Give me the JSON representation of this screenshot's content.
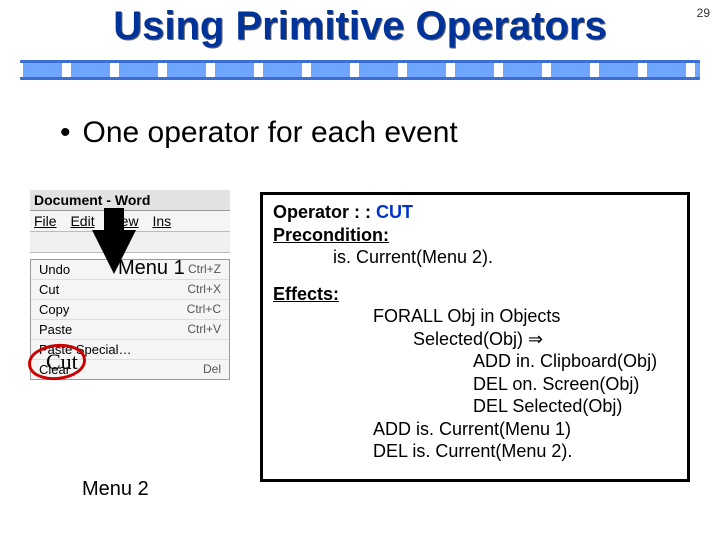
{
  "page_number": "29",
  "title": "Using Primitive Operators",
  "bullet": "One operator for each event",
  "word_window": {
    "title": "Document - Word",
    "menus": [
      "File",
      "Edit",
      "View",
      "Ins"
    ],
    "edit_menu_items": [
      {
        "label": "Undo",
        "key": "Ctrl+Z"
      },
      {
        "label": "Cut",
        "key": "Ctrl+X"
      },
      {
        "label": "Copy",
        "key": "Ctrl+C"
      },
      {
        "label": "Paste",
        "key": "Ctrl+V"
      },
      {
        "label": "Paste Special…",
        "key": ""
      },
      {
        "label": "Clear",
        "key": "Del"
      }
    ]
  },
  "labels": {
    "menu1": "Menu 1",
    "menu2": "Menu 2",
    "cut": "Cut"
  },
  "operator": {
    "header": "Operator : :",
    "name": "CUT",
    "pre_label": "Precondition:",
    "pre_clause": "is. Current(Menu 2).",
    "eff_label": "Effects:",
    "lines": [
      "FORALL Obj in Objects",
      "Selected(Obj) ⇒",
      "ADD in. Clipboard(Obj)",
      "DEL on. Screen(Obj)",
      "DEL Selected(Obj)",
      "ADD is. Current(Menu 1)",
      "DEL is. Current(Menu 2)."
    ]
  }
}
